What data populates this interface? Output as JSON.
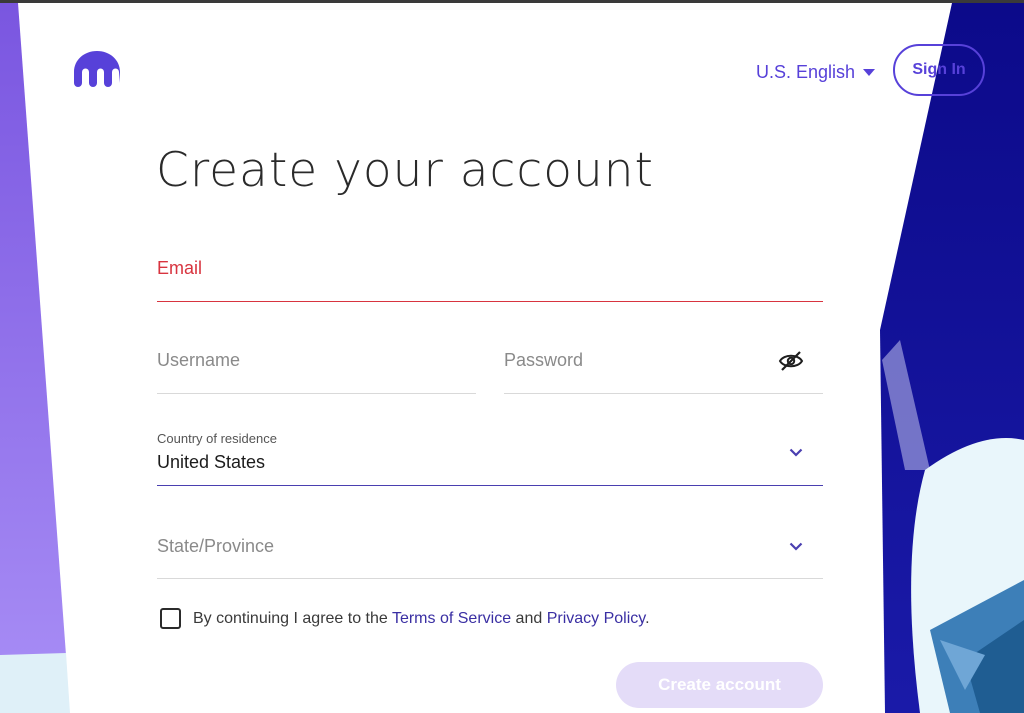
{
  "header": {
    "language_label": "U.S. English",
    "signin_label": "Sign In"
  },
  "page": {
    "title": "Create your account"
  },
  "form": {
    "email_placeholder": "Email",
    "username_placeholder": "Username",
    "password_placeholder": "Password",
    "country_label": "Country of residence",
    "country_value": "United States",
    "state_placeholder": "State/Province",
    "consent": {
      "prefix": "By continuing I agree to the ",
      "terms_link": "Terms of Service",
      "middle": " and ",
      "privacy_link": "Privacy Policy",
      "suffix": "."
    },
    "create_button_label": "Create account"
  },
  "icons": {
    "logo": "kraken-logo",
    "language_caret": "caret-down-icon",
    "password_toggle": "eye-slash-icon",
    "select_chevron": "chevron-down-icon"
  },
  "colors": {
    "brand": "#5741d9",
    "error": "#d8343f",
    "create_button_disabled": "#e4dcf8"
  }
}
